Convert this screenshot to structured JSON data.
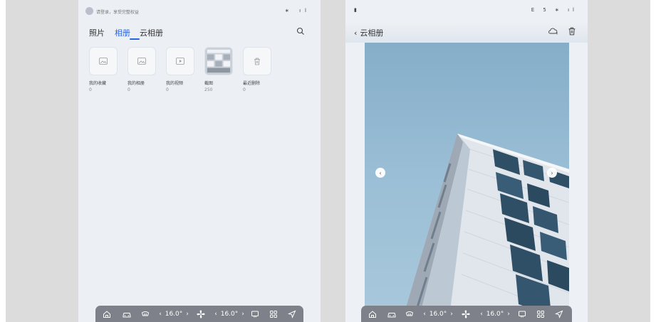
{
  "left_panel": {
    "status": {
      "text": "请登录，享受完整权益",
      "icons": "∗ ıl"
    },
    "tabs": [
      {
        "label": "照片"
      },
      {
        "label": "相册"
      },
      {
        "label": "云相册"
      }
    ],
    "albums": [
      {
        "name": "我的收藏",
        "count": "0",
        "icon": "image-icon"
      },
      {
        "name": "我的相册",
        "count": "0",
        "icon": "image-icon"
      },
      {
        "name": "我的视频",
        "count": "0",
        "icon": "video-icon"
      },
      {
        "name": "截图",
        "count": "250",
        "icon": "screenshot-thumbnail"
      },
      {
        "name": "最近删除",
        "count": "0",
        "icon": "trash-icon"
      }
    ]
  },
  "right_panel": {
    "status": {
      "left_icon": "▮",
      "right_icons": "E 5 ∗ ıl"
    },
    "header": {
      "back_label": "云相册"
    }
  },
  "dock": {
    "temp_left": "16.0°",
    "temp_right": "16.0°",
    "prev_symbol": "‹",
    "next_symbol": "›"
  },
  "colors": {
    "accent": "#2a64e6",
    "dock_bg": "#7e8189",
    "sky": "#9bbfd6"
  }
}
